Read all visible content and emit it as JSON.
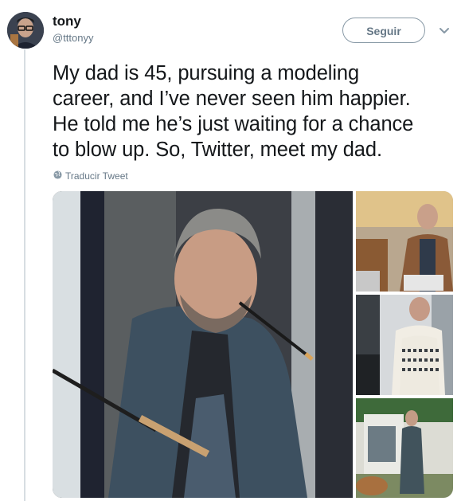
{
  "user": {
    "name": "tony",
    "handle": "@tttonyy"
  },
  "follow_label": "Seguir",
  "tweet": {
    "lines": [
      "My dad is 45, pursuing a modeling",
      "career, and I’ve never seen him happier.",
      "He told me he’s just waiting for a chance",
      "to blow up. So, Twitter, meet my dad."
    ],
    "translate_label": "Traducir Tweet"
  },
  "icons": {
    "more": "chevron-down-icon",
    "translate": "globe-icon"
  },
  "colors": {
    "text": "#14171a",
    "secondary": "#657786",
    "border": "#8899a6",
    "thread": "#d7dde2"
  }
}
